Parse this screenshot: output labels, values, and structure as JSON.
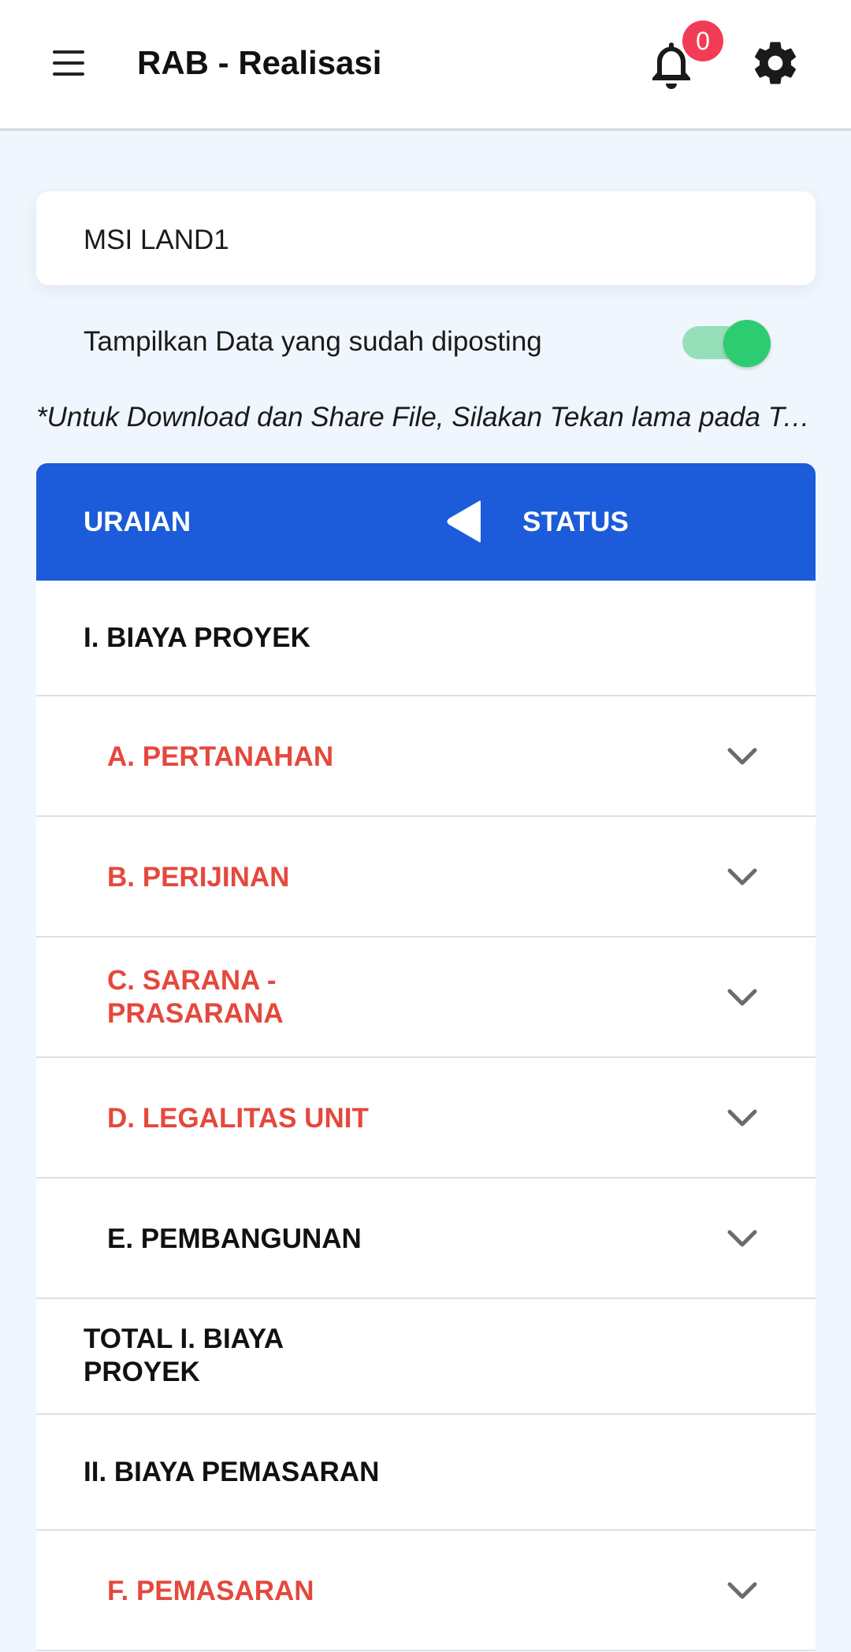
{
  "app_bar": {
    "title": "RAB - Realisasi",
    "notification_count": "0"
  },
  "project": {
    "name": "MSI LAND1"
  },
  "filter": {
    "show_posted_label": "Tampilkan Data yang sudah diposting",
    "show_posted_enabled": true
  },
  "hint": "*Untuk Download dan Share File, Silakan Tekan lama pada Tabel",
  "table": {
    "header": {
      "uraian": "URAIAN",
      "status": "STATUS"
    },
    "rows": [
      {
        "label": "I. BIAYA PROYEK",
        "kind": "section"
      },
      {
        "label": "A. PERTANAHAN",
        "kind": "item",
        "color": "#e5483c"
      },
      {
        "label": "B. PERIJINAN",
        "kind": "item",
        "color": "#e5483c"
      },
      {
        "label": "C. SARANA -\nPRASARANA",
        "kind": "item",
        "color": "#e5483c"
      },
      {
        "label": "D. LEGALITAS UNIT",
        "kind": "item",
        "color": "#e5483c"
      },
      {
        "label": "E. PEMBANGUNAN",
        "kind": "item",
        "color": "#111111"
      },
      {
        "label": "TOTAL I. BIAYA\nPROYEK",
        "kind": "total"
      },
      {
        "label": "II. BIAYA PEMASARAN",
        "kind": "section"
      },
      {
        "label": "F. PEMASARAN",
        "kind": "item",
        "color": "#e5483c"
      }
    ]
  },
  "colors": {
    "header_blue": "#1c5bd9",
    "item_red": "#e5483c",
    "toggle_green": "#2ecc71",
    "badge_red": "#f23b55"
  },
  "icons": [
    "menu-icon",
    "bell-icon",
    "gear-icon",
    "collapse-left-icon",
    "chevron-down-icon"
  ]
}
